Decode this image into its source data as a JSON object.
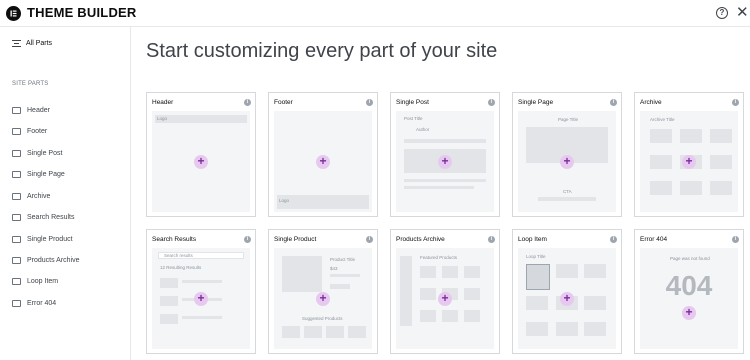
{
  "app": {
    "title": "THEME BUILDER",
    "logo_icon": "elementor-logo-icon",
    "help_icon": "question-circle-icon",
    "close_icon": "close-icon"
  },
  "sidebar": {
    "all_parts": "All Parts",
    "section_title": "SITE PARTS",
    "items": [
      {
        "label": "Header",
        "icon": "header-icon"
      },
      {
        "label": "Footer",
        "icon": "footer-icon"
      },
      {
        "label": "Single Post",
        "icon": "single-post-icon"
      },
      {
        "label": "Single Page",
        "icon": "single-page-icon"
      },
      {
        "label": "Archive",
        "icon": "archive-icon"
      },
      {
        "label": "Search Results",
        "icon": "search-results-icon"
      },
      {
        "label": "Single Product",
        "icon": "single-product-icon"
      },
      {
        "label": "Products Archive",
        "icon": "products-archive-icon"
      },
      {
        "label": "Loop Item",
        "icon": "loop-item-icon"
      },
      {
        "label": "Error 404",
        "icon": "error-404-icon"
      }
    ]
  },
  "main": {
    "heading": "Start customizing every part of your site",
    "cards": [
      {
        "title": "Header",
        "t1": "Logo"
      },
      {
        "title": "Footer",
        "t1": "Logo"
      },
      {
        "title": "Single Post",
        "t1": "Post Title",
        "t2": "Author"
      },
      {
        "title": "Single Page",
        "t1": "Page Title",
        "t2": "CTA"
      },
      {
        "title": "Archive",
        "t1": "Archive Title"
      },
      {
        "title": "Search Results",
        "t1": "Search results",
        "t2": "12 Resulting Results"
      },
      {
        "title": "Single Product",
        "t1": "Product Title",
        "t2": "$43",
        "t3": "Suggested Products"
      },
      {
        "title": "Products Archive",
        "t1": "Featured Products"
      },
      {
        "title": "Loop Item",
        "t1": "Loop Title"
      },
      {
        "title": "Error 404",
        "t1": "Page was not found",
        "t2": "404"
      }
    ]
  },
  "colors": {
    "accent": "#7b2c9f",
    "plus_bg": "#e7c9ef"
  }
}
